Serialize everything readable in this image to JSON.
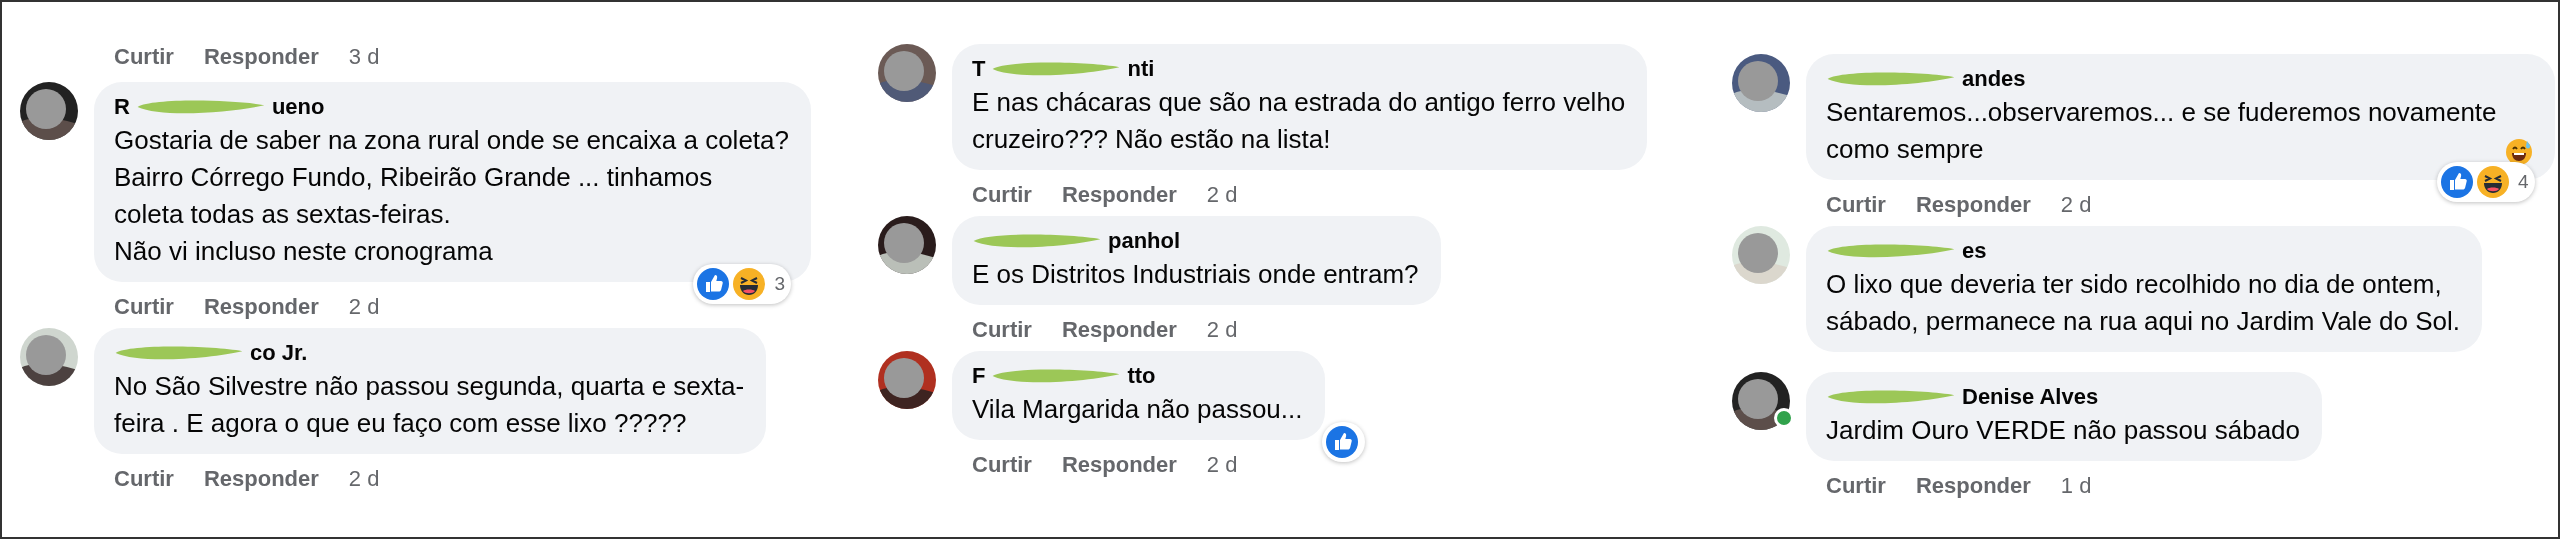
{
  "columns": [
    {
      "leading_actions": {
        "like": "Curtir",
        "reply": "Responder",
        "time": "3 d"
      },
      "comments": [
        {
          "name_start": "R",
          "name_end": "ueno",
          "text": "Gostaria de saber na zona rural onde se encaixa a coleta?\nBairro Córrego Fundo, Ribeirão Grande ... tinhamos\ncoleta todas as sextas-feiras.\nNão vi incluso neste cronograma",
          "online": false,
          "reactions": {
            "haha": true,
            "count": "3"
          },
          "actions": {
            "like": "Curtir",
            "reply": "Responder",
            "time": "2 d"
          }
        },
        {
          "name_end": "co Jr.",
          "text": "No São Silvestre não passou segunda, quarta e sexta-\nfeira . E agora o que eu faço com esse lixo ?????",
          "online": false,
          "actions": {
            "like": "Curtir",
            "reply": "Responder",
            "time": "2 d"
          }
        }
      ]
    },
    {
      "comments": [
        {
          "name_start": "T",
          "name_end": "nti",
          "text": "E nas chácaras que são na estrada do antigo ferro velho\ncruzeiro??? Não estão na lista!",
          "online": false,
          "actions": {
            "like": "Curtir",
            "reply": "Responder",
            "time": "2 d"
          }
        },
        {
          "name_end": "panhol",
          "text": "E os Distritos Industriais onde entram?",
          "online": false,
          "actions": {
            "like": "Curtir",
            "reply": "Responder",
            "time": "2 d"
          }
        },
        {
          "name_start": "F",
          "name_end": "tto",
          "text": "Vila Margarida não passou...",
          "online": false,
          "reactions": {
            "haha": false
          },
          "actions": {
            "like": "Curtir",
            "reply": "Responder",
            "time": "2 d"
          }
        }
      ]
    },
    {
      "comments": [
        {
          "name_end": "andes",
          "text": "Sentaremos...observaremos... e se fuderemos novamente\ncomo sempre",
          "emoji": true,
          "online": false,
          "reactions": {
            "haha": true,
            "count": "4"
          },
          "actions": {
            "like": "Curtir",
            "reply": "Responder",
            "time": "2 d"
          }
        },
        {
          "name_end": "es",
          "text": "O lixo que deveria ter sido recolhido no dia de ontem,\nsábado, permanece na rua aqui no Jardim Vale do Sol.",
          "online": false
        },
        {
          "name_end": "Denise Alves",
          "text": "Jardim Ouro VERDE não passou sábado",
          "online": true,
          "actions": {
            "like": "Curtir",
            "reply": "Responder",
            "time": "1 d"
          }
        }
      ]
    }
  ]
}
